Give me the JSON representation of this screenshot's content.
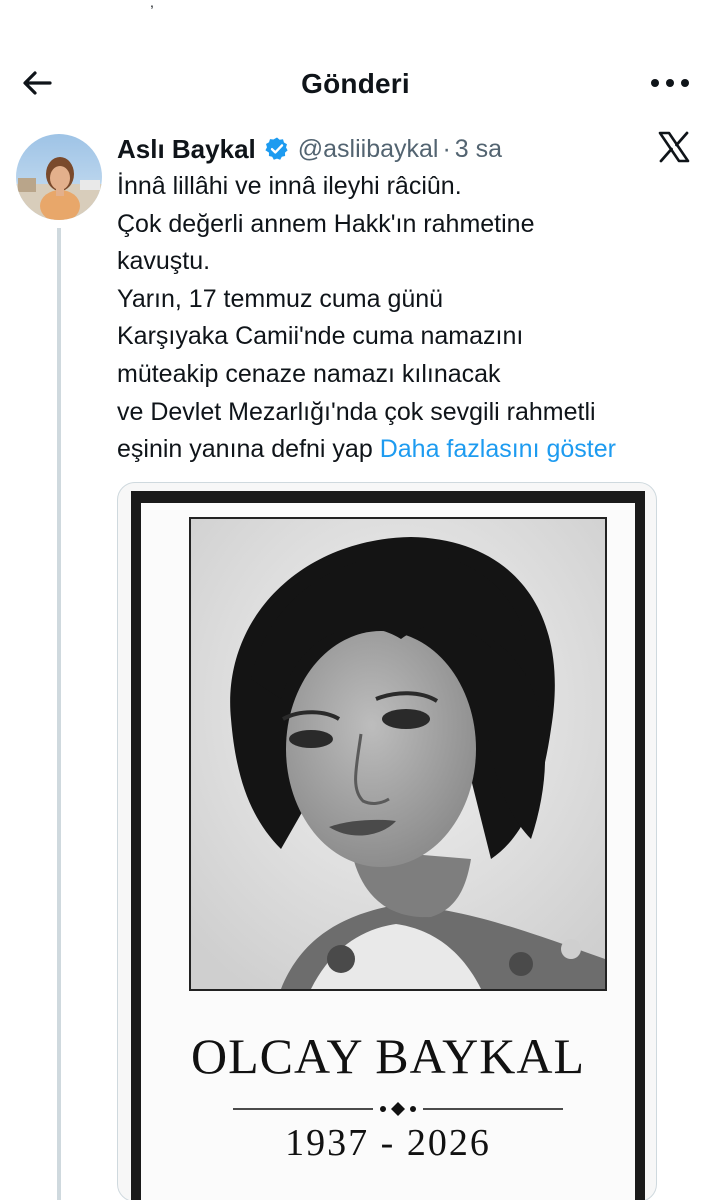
{
  "header": {
    "title": "Gönderi"
  },
  "post": {
    "author": {
      "name": "Aslı Baykal",
      "handle": "@asliibaykal",
      "verified": true
    },
    "time": "3 sa",
    "separator": "·",
    "text_lines": [
      "İnnâ lillâhi ve innâ ileyhi râciûn.",
      "Çok değerli annem Hakk'ın rahmetine",
      "kavuştu.",
      "Yarın, 17 temmuz cuma günü",
      "Karşıyaka Camii'nde cuma namazını",
      "müteakip cenaze namazı kılınacak",
      "ve Devlet Mezarlığı'nda çok sevgili rahmetli",
      "eşinin yanına defni yap"
    ],
    "show_more": "Daha fazlasını göster",
    "media": {
      "name": "OLCAY BAYKAL",
      "years": "1937 - 2026"
    }
  },
  "icons": {
    "back": "arrow-left-icon",
    "more": "more-horizontal-icon",
    "verified": "verified-badge-icon",
    "platform": "x-logo-icon"
  },
  "colors": {
    "link": "#1d9bf0",
    "secondary_text": "#536471",
    "thread_line": "#cfd9de",
    "verified": "#1d9bf0"
  }
}
